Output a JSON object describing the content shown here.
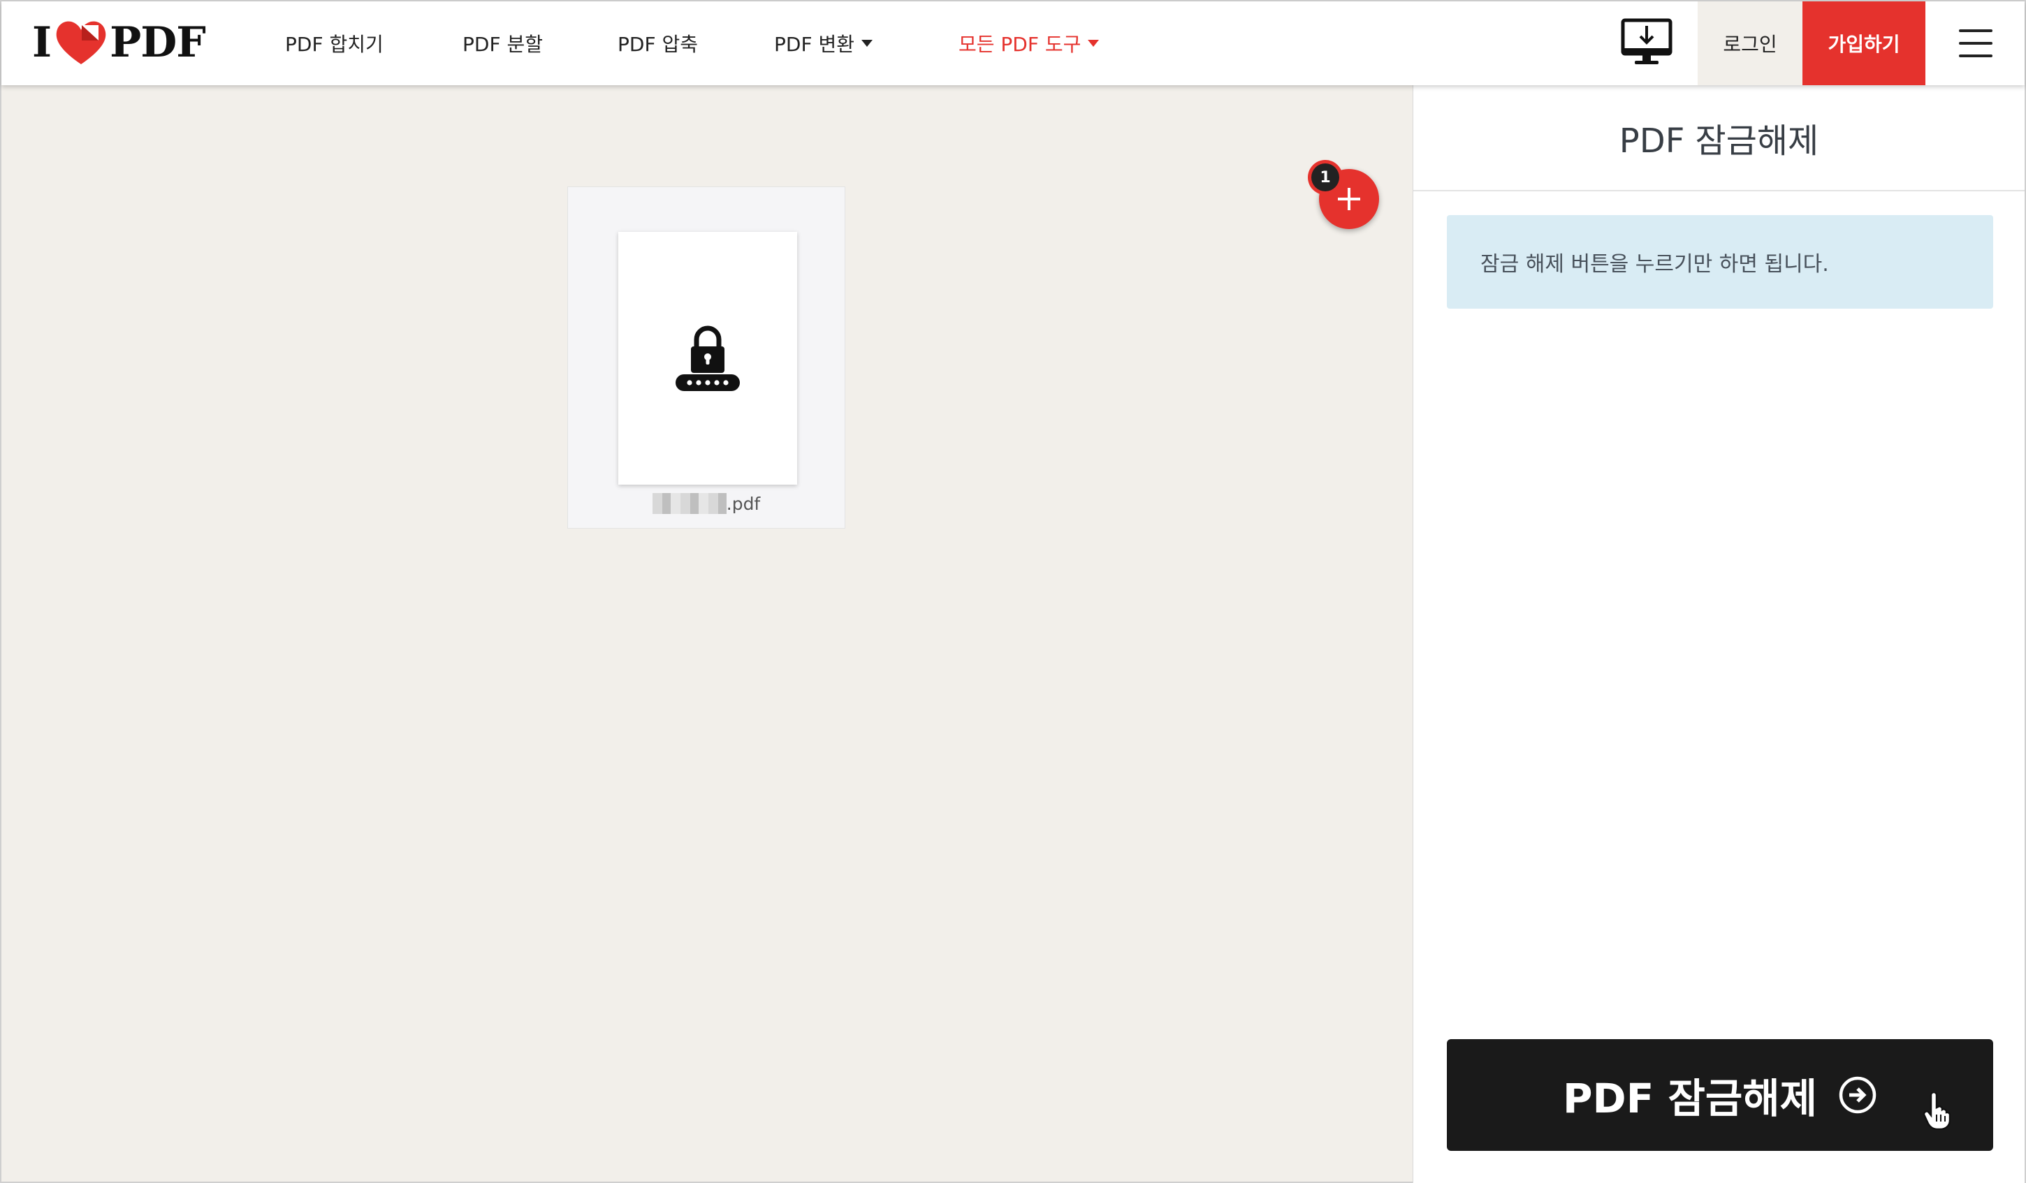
{
  "header": {
    "logo": {
      "prefix": "I",
      "suffix": "PDF",
      "icon": "heart-icon"
    },
    "nav": [
      {
        "label": "PDF 합치기",
        "dropdown": false,
        "accent": false
      },
      {
        "label": "PDF 분할",
        "dropdown": false,
        "accent": false
      },
      {
        "label": "PDF 압축",
        "dropdown": false,
        "accent": false
      },
      {
        "label": "PDF 변환",
        "dropdown": true,
        "accent": false
      },
      {
        "label": "모든 PDF 도구",
        "dropdown": true,
        "accent": true
      }
    ],
    "desktop_icon": "desktop-download-icon",
    "login_label": "로그인",
    "signup_label": "가입하기",
    "menu_icon": "hamburger-menu-icon"
  },
  "workspace": {
    "file": {
      "name_suffix": ".pdf",
      "icon": "lock-password-icon"
    },
    "add_button_icon": "plus-icon",
    "file_count": "1"
  },
  "sidebar": {
    "title": "PDF 잠금해제",
    "info_text": "잠금 해제 버튼을 누르기만 하면 됩니다.",
    "action_label": "PDF 잠금해제",
    "action_icon": "arrow-right-circle-icon"
  },
  "colors": {
    "brand_red": "#e5322d",
    "background": "#f2efea",
    "info_box": "#d9ecf4",
    "action_button": "#1a1a1a"
  }
}
